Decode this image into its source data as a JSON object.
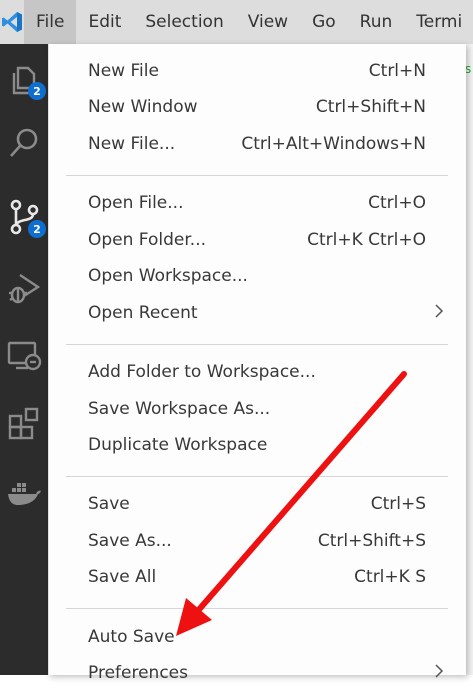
{
  "menubar": {
    "items": [
      {
        "label": "File"
      },
      {
        "label": "Edit"
      },
      {
        "label": "Selection"
      },
      {
        "label": "View"
      },
      {
        "label": "Go"
      },
      {
        "label": "Run"
      },
      {
        "label": "Termi"
      }
    ],
    "active": "File"
  },
  "activity": {
    "explorer_badge": "2",
    "scm_badge": "2"
  },
  "file_menu": {
    "groups": [
      [
        {
          "label": "New File",
          "shortcut": "Ctrl+N"
        },
        {
          "label": "New Window",
          "shortcut": "Ctrl+Shift+N"
        },
        {
          "label": "New File...",
          "shortcut": "Ctrl+Alt+Windows+N"
        }
      ],
      [
        {
          "label": "Open File...",
          "shortcut": "Ctrl+O"
        },
        {
          "label": "Open Folder...",
          "shortcut": "Ctrl+K Ctrl+O"
        },
        {
          "label": "Open Workspace...",
          "shortcut": ""
        },
        {
          "label": "Open Recent",
          "shortcut": "",
          "submenu": true
        }
      ],
      [
        {
          "label": "Add Folder to Workspace...",
          "shortcut": ""
        },
        {
          "label": "Save Workspace As...",
          "shortcut": ""
        },
        {
          "label": "Duplicate Workspace",
          "shortcut": ""
        }
      ],
      [
        {
          "label": "Save",
          "shortcut": "Ctrl+S"
        },
        {
          "label": "Save As...",
          "shortcut": "Ctrl+Shift+S"
        },
        {
          "label": "Save All",
          "shortcut": "Ctrl+K S"
        }
      ],
      [
        {
          "label": "Auto Save",
          "shortcut": ""
        },
        {
          "label": "Preferences",
          "shortcut": "",
          "submenu": true
        }
      ]
    ]
  },
  "editor_hint": "s",
  "colors": {
    "activity_bg": "#2c2c2c",
    "menubar_bg": "#dddddd",
    "badge": "#0f6fd1",
    "annotation_arrow": "#ee1111",
    "vscode_blue": "#2f8fe0"
  }
}
